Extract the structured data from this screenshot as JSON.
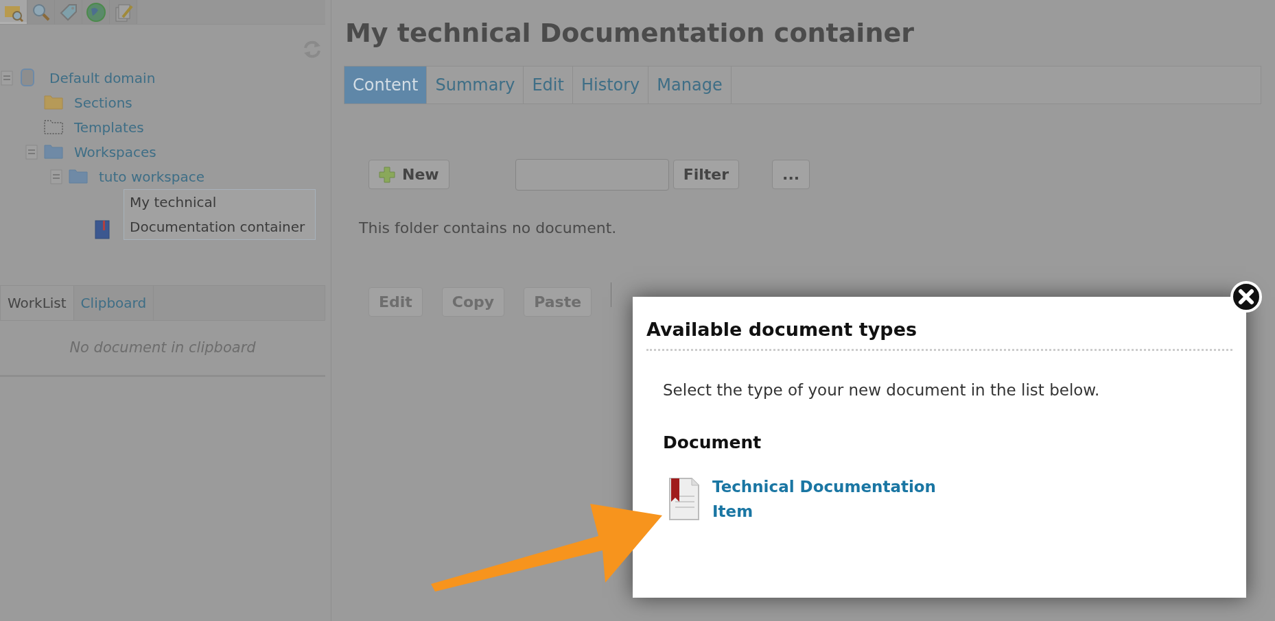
{
  "sidebar": {
    "toolbar_tabs": [
      {
        "kind": "folder-search",
        "selected": true
      },
      {
        "kind": "search",
        "selected": false
      },
      {
        "kind": "tag",
        "selected": false
      },
      {
        "kind": "globe",
        "selected": false
      },
      {
        "kind": "edit",
        "selected": false
      }
    ],
    "tree": [
      {
        "label": "Default domain",
        "kind": "domain",
        "expanded": true,
        "selected": false,
        "children": [
          {
            "label": "Sections",
            "kind": "folder",
            "expanded": false,
            "selected": false
          },
          {
            "label": "Templates",
            "kind": "template",
            "expanded": false,
            "selected": false
          },
          {
            "label": "Workspaces",
            "kind": "workspace",
            "expanded": true,
            "selected": false,
            "children": [
              {
                "label": "tuto workspace",
                "kind": "workspace",
                "expanded": true,
                "selected": false,
                "children": [
                  {
                    "label": "My technical Documentation container",
                    "kind": "document",
                    "expanded": false,
                    "selected": true
                  }
                ]
              }
            ]
          }
        ]
      }
    ],
    "bottom_tabs": [
      {
        "label": "WorkList",
        "selected": true
      },
      {
        "label": "Clipboard",
        "selected": false
      }
    ],
    "empty_message": "No document in clipboard"
  },
  "main": {
    "title": "My technical Documentation container",
    "tabs": [
      {
        "label": "Content",
        "selected": true
      },
      {
        "label": "Summary",
        "selected": false
      },
      {
        "label": "Edit",
        "selected": false
      },
      {
        "label": "History",
        "selected": false
      },
      {
        "label": "Manage",
        "selected": false
      }
    ],
    "new_button": "New",
    "filter_button": "Filter",
    "more_button": "...",
    "empty_message": "This folder contains no document.",
    "actions": [
      {
        "label": "Edit",
        "disabled": true
      },
      {
        "label": "Copy",
        "disabled": true
      },
      {
        "label": "Paste",
        "disabled": true
      }
    ]
  },
  "dialog": {
    "title": "Available document types",
    "instruction": "Select the type of your new document in the list below.",
    "groups": [
      {
        "heading": "Document",
        "items": [
          {
            "label": "Technical Documentation Item"
          }
        ]
      }
    ]
  }
}
